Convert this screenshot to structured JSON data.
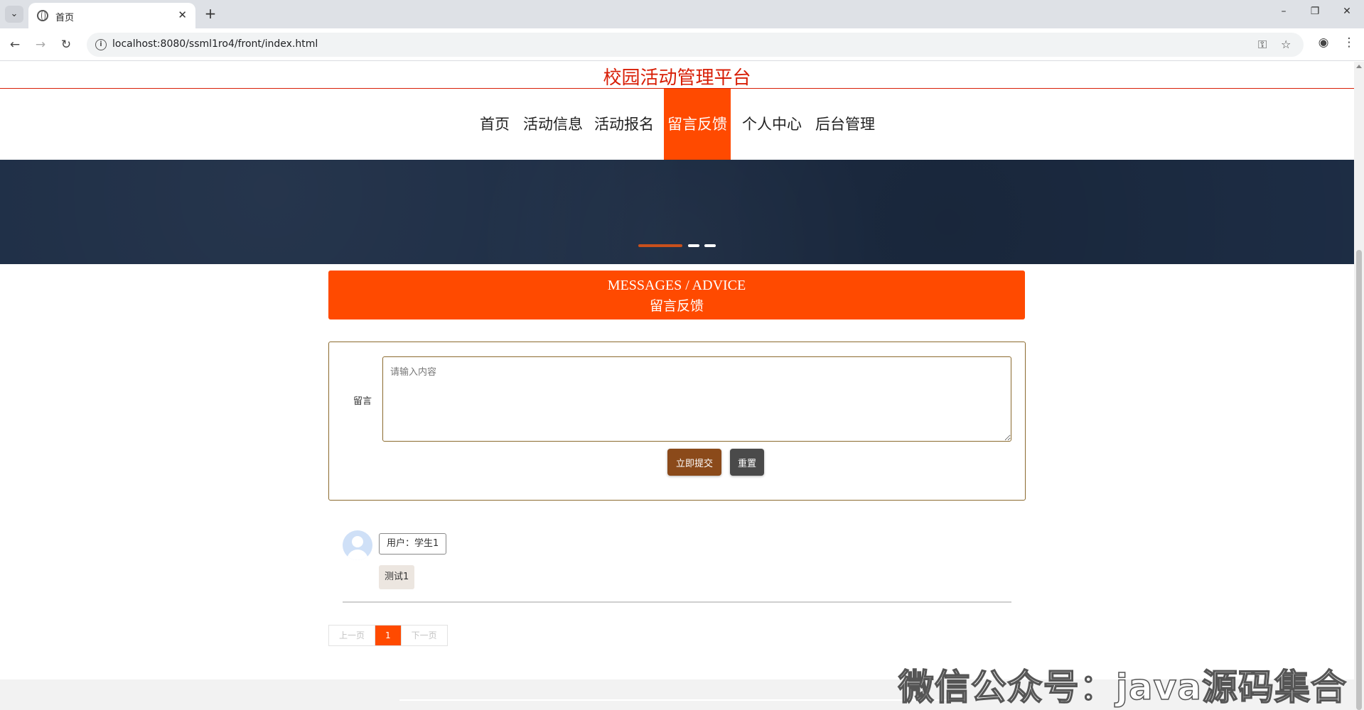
{
  "browser": {
    "tab_title": "首页",
    "url": "localhost:8080/ssml1ro4/front/index.html",
    "new_tab": "+",
    "close_tab": "✕"
  },
  "site": {
    "title": "校园活动管理平台"
  },
  "nav": {
    "items": [
      {
        "label": "首页"
      },
      {
        "label": "活动信息"
      },
      {
        "label": "活动报名"
      },
      {
        "label": "留言反馈"
      },
      {
        "label": "个人中心"
      },
      {
        "label": "后台管理"
      }
    ],
    "active_index": 3
  },
  "section": {
    "title_en": "MESSAGES / ADVICE",
    "title_zh": "留言反馈"
  },
  "form": {
    "label": "留言",
    "placeholder": "请输入内容",
    "submit_label": "立即提交",
    "reset_label": "重置"
  },
  "messages": [
    {
      "user": "用户：学生1",
      "content": "测试1"
    }
  ],
  "pager": {
    "prev": "上一页",
    "current": "1",
    "next": "下一页"
  },
  "watermark": "微信公众号：java源码集合",
  "colors": {
    "accent": "#ff4a00",
    "title_red": "#d81e06",
    "banner": "#1d2d45",
    "submit": "#8b4a1a",
    "reset": "#4a4a4a"
  }
}
